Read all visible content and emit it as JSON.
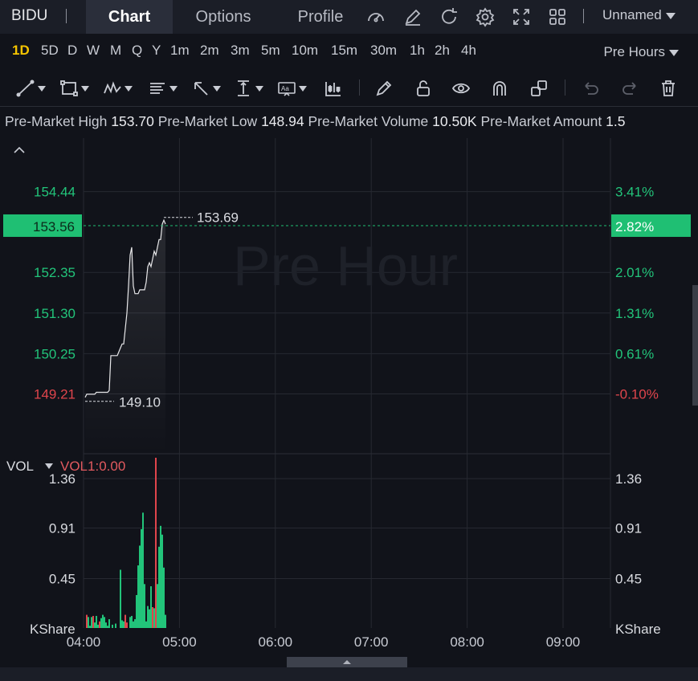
{
  "header": {
    "ticker": "BIDU",
    "tabs": [
      "Chart",
      "Options",
      "Profile"
    ],
    "active_tab": "Chart",
    "icons": [
      "gauge-icon",
      "edit-icon",
      "refresh-icon",
      "settings-icon",
      "fullscreen-icon",
      "grid-layout-icon"
    ],
    "layout_name": "Unnamed"
  },
  "periods": {
    "items": [
      "1D",
      "5D",
      "D",
      "W",
      "M",
      "Q",
      "Y",
      "1m",
      "2m",
      "3m",
      "5m",
      "10m",
      "15m",
      "30m",
      "1h",
      "2h",
      "4h"
    ],
    "active": "1D",
    "session": "Pre Hours"
  },
  "tools": [
    "line-tool-icon",
    "rectangle-tool-icon",
    "pattern-tool-icon",
    "fibonacci-tool-icon",
    "arrow-tool-icon",
    "measure-tool-icon",
    "text-tool-icon",
    "indicator-tool-icon",
    "pencil-icon",
    "unlock-icon",
    "eye-icon",
    "magnet-icon",
    "clone-icon",
    "undo-icon",
    "redo-icon",
    "trash-icon"
  ],
  "info": {
    "high_label": "Pre-Market High",
    "high_value": "153.70",
    "low_label": "Pre-Market Low",
    "low_value": "148.94",
    "volume_label": "Pre-Market Volume",
    "volume_value": "10.50K",
    "amount_label": "Pre-Market Amount",
    "amount_value": "1.5"
  },
  "chart_data": [
    {
      "type": "line",
      "watermark": "Pre Hour",
      "y_left_ticks": [
        "154.44",
        "152.35",
        "151.30",
        "150.25",
        "149.21"
      ],
      "y_right_ticks": [
        "3.41%",
        "2.01%",
        "1.31%",
        "0.61%",
        "-0.10%"
      ],
      "ylim": [
        148.7,
        155.2
      ],
      "current_price": "153.56",
      "current_change": "2.82%",
      "high_label": "153.69",
      "low_label": "149.10",
      "x_ticks": [
        "04:00",
        "05:00",
        "06:00",
        "07:00",
        "08:00",
        "09:00"
      ],
      "colors": {
        "up": "#22c47a",
        "down": "#e0454c",
        "line": "#e8e8ea",
        "price_tag": "#1fbf73"
      },
      "series": [
        {
          "name": "",
          "x": [
            0,
            1,
            2,
            3,
            4,
            5,
            6,
            7,
            8,
            9,
            10,
            11,
            12,
            13,
            14,
            15,
            16,
            17,
            18,
            19,
            20,
            21,
            22,
            23,
            24,
            25,
            26,
            27,
            28,
            29,
            30,
            31,
            32,
            33,
            34,
            35,
            36,
            37,
            38,
            39,
            40,
            41,
            42,
            43,
            44,
            45,
            46,
            47,
            48,
            49,
            50
          ],
          "values": [
            149.12,
            149.2,
            149.2,
            149.2,
            149.2,
            149.2,
            149.2,
            149.25,
            149.25,
            149.25,
            149.25,
            149.25,
            149.25,
            149.25,
            149.25,
            149.3,
            150.2,
            150.2,
            150.2,
            150.2,
            150.2,
            150.3,
            150.4,
            150.5,
            150.5,
            150.9,
            151.3,
            152.0,
            152.8,
            153.0,
            152.0,
            151.8,
            151.8,
            151.8,
            151.9,
            151.9,
            151.9,
            151.9,
            152.1,
            152.5,
            152.6,
            152.5,
            152.7,
            152.9,
            152.8,
            153.0,
            153.2,
            153.2,
            153.6,
            153.7,
            153.6
          ]
        }
      ]
    },
    {
      "type": "bar",
      "title": "VOL",
      "legend": "VOL1:0.00",
      "unit": "KShare",
      "y_ticks": [
        "1.36",
        "0.91",
        "0.45"
      ],
      "ylim": [
        0,
        1.55
      ],
      "x": [
        1,
        2,
        3,
        4,
        5,
        6,
        7,
        8,
        9,
        10,
        11,
        12,
        13,
        14,
        15,
        17,
        19,
        22,
        23,
        24,
        25,
        26,
        28,
        29,
        30,
        31,
        32,
        33,
        34,
        35,
        36,
        37,
        38,
        39,
        40,
        41,
        42,
        43,
        44,
        45,
        46,
        47,
        48,
        49,
        50
      ],
      "values": [
        0.12,
        0.1,
        0.02,
        0.1,
        0.11,
        0.05,
        0.11,
        0.03,
        0.06,
        0.09,
        0.12,
        0.1,
        0.05,
        0.02,
        0.08,
        0.03,
        0.04,
        0.53,
        0.07,
        0.06,
        0.12,
        0.05,
        0.1,
        0.11,
        0.06,
        0.08,
        0.3,
        0.57,
        0.75,
        0.9,
        1.05,
        0.4,
        0.06,
        0.2,
        0.17,
        0.38,
        0.19,
        0.18,
        1.55,
        0.4,
        0.74,
        0.93,
        0.85,
        0.55,
        0.12
      ],
      "directions": [
        "down",
        "up",
        "up",
        "up",
        "down",
        "up",
        "up",
        "up",
        "down",
        "up",
        "up",
        "up",
        "up",
        "up",
        "up",
        "up",
        "up",
        "up",
        "up",
        "up",
        "down",
        "down",
        "up",
        "up",
        "up",
        "up",
        "up",
        "up",
        "up",
        "up",
        "up",
        "up",
        "up",
        "up",
        "up",
        "up",
        "down",
        "up",
        "down",
        "up",
        "up",
        "up",
        "up",
        "up",
        "up"
      ]
    }
  ]
}
